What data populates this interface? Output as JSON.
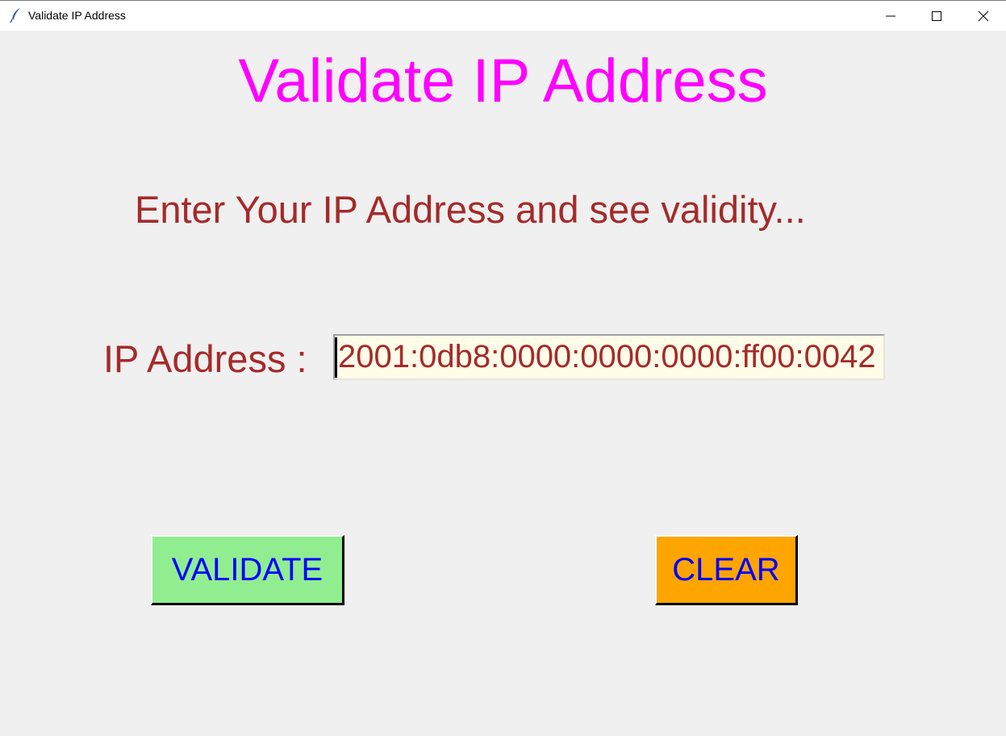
{
  "window": {
    "title": "Validate IP Address",
    "controls": {
      "minimize_icon": "minimize-icon",
      "maximize_icon": "maximize-icon",
      "close_icon": "close-icon"
    },
    "app_icon": "feather-icon"
  },
  "main": {
    "heading": "Validate IP Address",
    "subheading": "Enter Your IP Address and see validity...",
    "ip_label": "IP Address :",
    "ip_value": "2001:0db8:0000:0000:0000:ff00:0042",
    "validate_label": "VALIDATE",
    "clear_label": "CLEAR"
  },
  "colors": {
    "background": "#f0f0f0",
    "heading": "#ff00ff",
    "text": "#a52a2a",
    "input_bg": "#fffde8",
    "button_text": "#0000ff",
    "validate_bg": "#90ee90",
    "clear_bg": "#ffa500"
  }
}
